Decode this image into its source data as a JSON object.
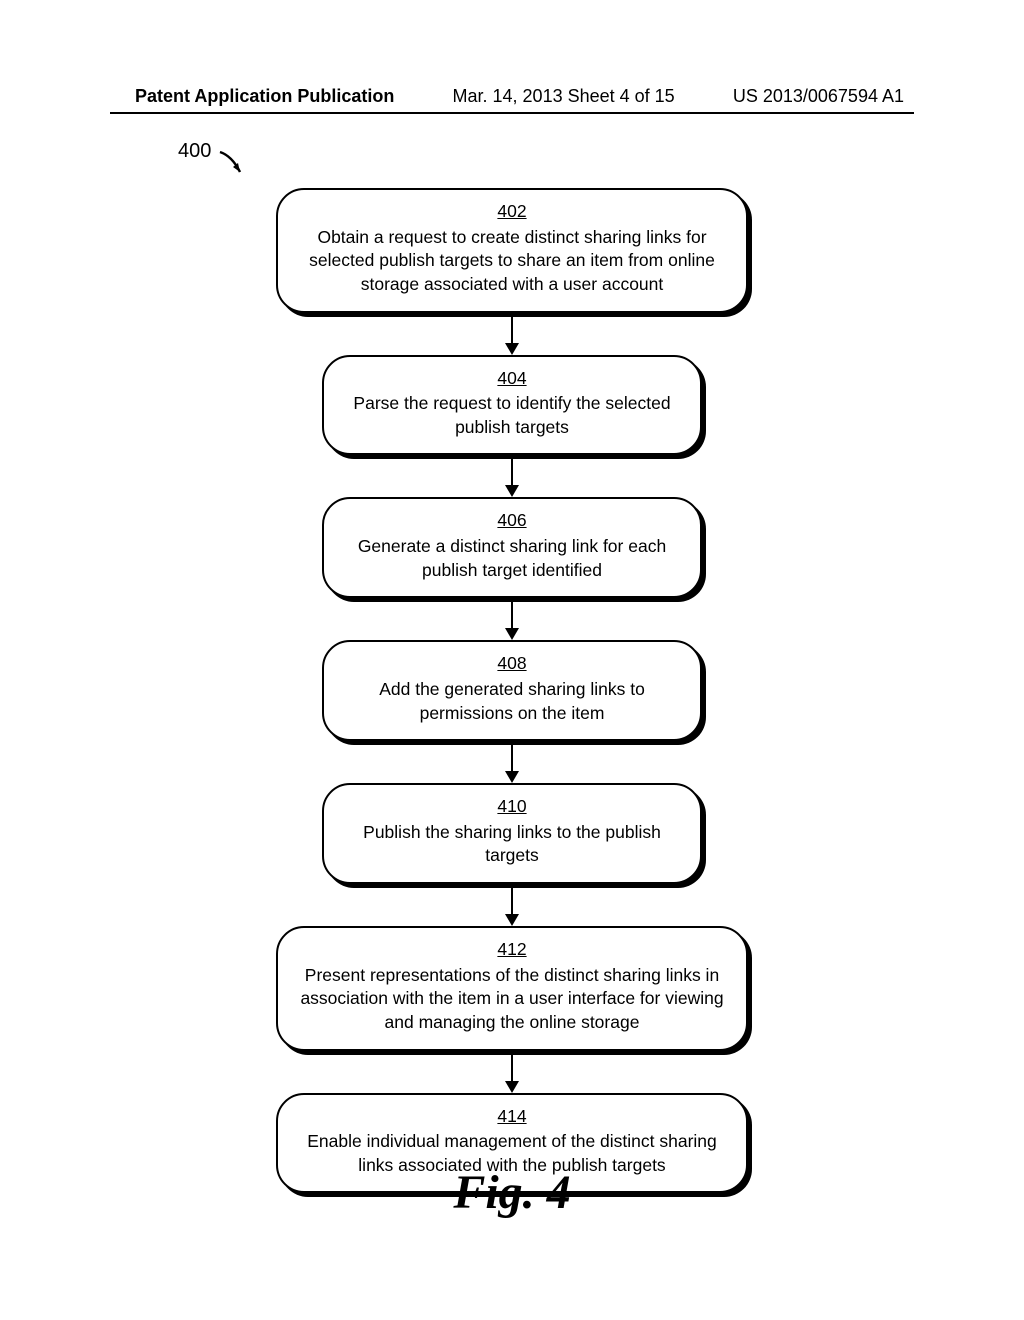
{
  "header": {
    "left": "Patent Application Publication",
    "center": "Mar. 14, 2013  Sheet 4 of 15",
    "right": "US 2013/0067594 A1"
  },
  "reference_number": "400",
  "chart_data": {
    "type": "flowchart",
    "direction": "top-to-bottom",
    "nodes": [
      {
        "id": "402",
        "width": "wide",
        "text": "Obtain a request to create distinct sharing links for selected publish targets to share an item from online storage associated with a user account"
      },
      {
        "id": "404",
        "width": "narrow",
        "text": "Parse the request to identify the selected publish targets"
      },
      {
        "id": "406",
        "width": "narrow",
        "text": "Generate a distinct sharing link for each publish target identified"
      },
      {
        "id": "408",
        "width": "narrow",
        "text": "Add the generated sharing links to permissions on the item"
      },
      {
        "id": "410",
        "width": "narrow",
        "text": "Publish the sharing links to the publish targets"
      },
      {
        "id": "412",
        "width": "wide",
        "text": "Present representations of the distinct sharing links in association with the item in a user interface for viewing and managing the online storage"
      },
      {
        "id": "414",
        "width": "wide",
        "text": "Enable individual management of the distinct sharing links associated with the publish targets"
      }
    ],
    "edges": [
      [
        "402",
        "404"
      ],
      [
        "404",
        "406"
      ],
      [
        "406",
        "408"
      ],
      [
        "408",
        "410"
      ],
      [
        "410",
        "412"
      ],
      [
        "412",
        "414"
      ]
    ]
  },
  "figure_caption": "Fig. 4"
}
